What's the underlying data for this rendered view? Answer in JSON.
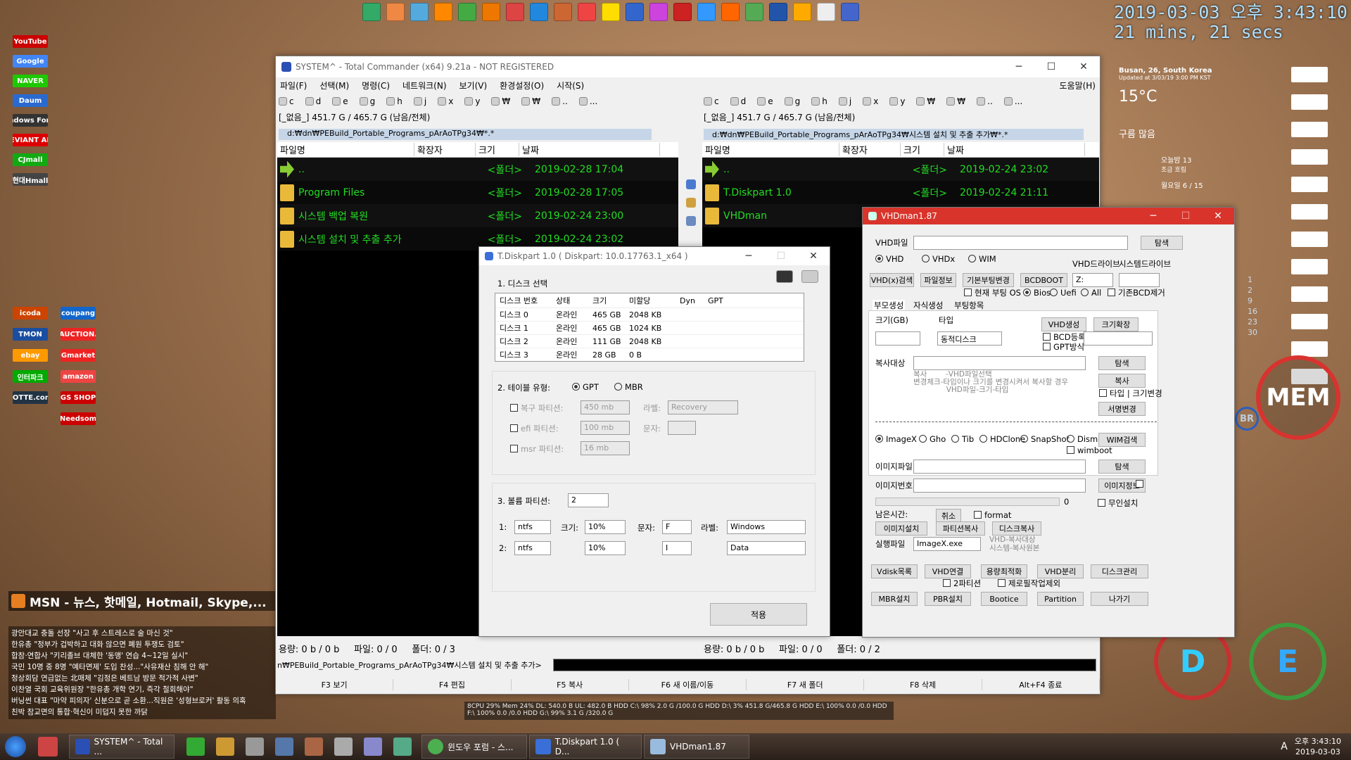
{
  "clock": {
    "date_time": "2019-03-03 오후 3:43:10",
    "uptime": "21 mins, 21 secs"
  },
  "weather": {
    "location": "Busan, 26, South Korea",
    "updated": "Updated at 3/03/19 3:00 PM KST",
    "temp": "15°C",
    "condition": "구름 많음",
    "today": "오늘밤 13",
    "today_note": "조금 흐림",
    "tomorrow": "월요일 6 / 15"
  },
  "calendar": [
    "1",
    "2",
    "9",
    "16",
    "23",
    "30"
  ],
  "left_sites": [
    "YouTube",
    "Google",
    "NAVER",
    "Daum",
    "Windows Forum",
    "DEVIANT ART",
    "CJmall",
    "현대Hmall",
    "coupang",
    "icoda",
    "AUCTION.",
    "TMON",
    "Gmarket",
    "ebay",
    "amazon",
    "인터파크",
    "GS SHOP",
    "LOTTE.com",
    "Needsom"
  ],
  "msn": {
    "title": "MSN - 뉴스, 핫메일, Hotmail, Skype,...",
    "headlines": [
      "광안대교 충돌 선장 \"사고 후 스트레스로 술 마신 것\"",
      "한유총 \"정부가 겁박하고 대화 않으면 폐원 투쟁도 검토\"",
      "합참·연합사 \"키리졸브 대체한 '동맹' 연습 4~12일 실시\"",
      "국민 10명 중 8명 \"예타면제' 도입 찬성...\"사유재산 침해 안 해\"",
      "정상회담 연급없는 北매체 \"김정은 베트남 방문 적가적 사변\"",
      "이찬열 국회 교육위원장 \"한유총 개학 연기, 즉각 철회해야\"",
      "버닝썬 대표 \"마약 피의자' 신분으로 곧 소환...직원은 '성형브로커' 활동 의혹",
      "친박 참교면의 통합·혁신이 미덥지 못한 까닭"
    ]
  },
  "tc": {
    "title": "SYSTEM^ - Total Commander (x64) 9.21a - NOT REGISTERED",
    "menu": [
      "파일(F)",
      "선택(M)",
      "명령(C)",
      "네트워크(N)",
      "보기(V)",
      "환경설정(O)",
      "시작(S)"
    ],
    "help": "도움말(H)",
    "drives": [
      "c",
      "d",
      "e",
      "g",
      "h",
      "j",
      "x",
      "y",
      "₩",
      "₩",
      "..",
      "..."
    ],
    "left": {
      "freeinfo": "[_없음_]  451.7 G / 465.7 G (남음/전체)",
      "path": "d:₩dn₩PEBuild_Portable_Programs_pArAoTPg34₩*.*",
      "cols": [
        "파일명",
        "확장자",
        "크기",
        "날짜"
      ],
      "rows": [
        {
          "name": "..",
          "size": "<폴더>",
          "date": "2019-02-28 17:04"
        },
        {
          "name": "Program Files",
          "size": "<폴더>",
          "date": "2019-02-28 17:05"
        },
        {
          "name": "시스템 백업 복원",
          "size": "<폴더>",
          "date": "2019-02-24 23:00"
        },
        {
          "name": "시스템 설치 및 추출 추가",
          "size": "<폴더>",
          "date": "2019-02-24 23:02"
        }
      ],
      "status": "용량: 0 b / 0 b     파일: 0 / 0     폴더: 0 / 3"
    },
    "right": {
      "freeinfo": "[_없음_]  451.7 G / 465.7 G (남음/전체)",
      "path": "d:₩dn₩PEBuild_Portable_Programs_pArAoTPg34₩시스템 설치 및 추출 추가₩*.*",
      "cols": [
        "파일명",
        "확장자",
        "크기",
        "날짜"
      ],
      "rows": [
        {
          "name": "..",
          "size": "<폴더>",
          "date": "2019-02-24 23:02"
        },
        {
          "name": "T.Diskpart 1.0",
          "size": "<폴더>",
          "date": "2019-02-24 21:11"
        },
        {
          "name": "VHDman",
          "size": "",
          "date": ""
        }
      ],
      "status": "용량: 0 b / 0 b     파일: 0 / 0     폴더: 0 / 2"
    },
    "cmdline": "n₩PEBuild_Portable_Programs_pArAoTPg34₩시스템 설치 및 추출 추가>",
    "fkeys": [
      "F3 보기",
      "F4 편집",
      "F5 복사",
      "F6 새 이름/이동",
      "F7 새 폴더",
      "F8 삭제",
      "Alt+F4 종료"
    ]
  },
  "td": {
    "title": "T.Diskpart 1.0 ( Diskpart: 10.0.17763.1_x64 )",
    "sec1": "1. 디스크 선택",
    "cols": [
      "디스크 번호",
      "상태",
      "크기",
      "미할당",
      "Dyn",
      "GPT"
    ],
    "disks": [
      [
        "디스크 0",
        "온라인",
        "465 GB",
        "2048 KB"
      ],
      [
        "디스크 1",
        "온라인",
        "465 GB",
        "1024 KB"
      ],
      [
        "디스크 2",
        "온라인",
        "111 GB",
        "2048 KB"
      ],
      [
        "디스크 3",
        "온라인",
        "28 GB",
        "0 B"
      ]
    ],
    "sec2": "2. 테이블 유형:",
    "gpt": "GPT",
    "mbr": "MBR",
    "recovery": "복구 파티션:",
    "recovery_size": "450 mb",
    "label_txt": "라벨:",
    "recovery_label": "Recovery",
    "efi": "efi 파티션:",
    "efi_size": "100 mb",
    "letter_txt": "문자:",
    "msr": "msr 파티션:",
    "msr_size": "16 mb",
    "sec3": "3. 볼륨 파티션:",
    "vol_count": "2",
    "vols": [
      {
        "n": "1:",
        "fs": "ntfs",
        "size": "10%",
        "letter": "F",
        "label": "Windows"
      },
      {
        "n": "2:",
        "fs": "ntfs",
        "size": "10%",
        "letter": "I",
        "label": "Data"
      }
    ],
    "size_txt": "크기:",
    "letter2": "문자:",
    "label2": "라벨:",
    "apply": "적용"
  },
  "vhd": {
    "title": "VHDman1.87",
    "vhdfile": "VHD파일",
    "browse": "탐색",
    "r_vhd": "VHD",
    "r_vhdx": "VHDx",
    "r_wim": "WIM",
    "vhd_drive": "VHD드라이브",
    "sys_drive": "시스템드라이브",
    "drive_val": "Z:",
    "btn_search": "VHD(x)검색",
    "btn_info": "파일정보",
    "btn_bootchg": "기본부팅변경",
    "btn_bcd": "BCDBOOT",
    "cur_boot": "현재 부팅 OS",
    "bios": "Bios",
    "uefi": "Uefi",
    "all": "All",
    "bcd_remove": "기존BCD제거",
    "tabs": [
      "부모생성",
      "자식생성",
      "부팅항목"
    ],
    "size_gb": "크기(GB)",
    "type": "타입",
    "type_val": "동적디스크",
    "create": "VHD생성",
    "expand": "크기확장",
    "bcd_reg": "BCD등록",
    "gpt_mode": "GPT방식",
    "copy_target": "복사대상",
    "copy_note": "복사        -VHD파일선택\n변경체크-타입이나 크기를 변경시켜서 복사할 경우\n              VHD파일-크기-타입",
    "copy": "복사",
    "type_size_chg": "타입 | 크기변경",
    "sign_chg": "서명변경",
    "tools": [
      "ImageX",
      "Gho",
      "Tib",
      "HDClone",
      "SnapShot",
      "Dism"
    ],
    "wim_search": "WIM검색",
    "wimboot": "wimboot",
    "img_file": "이미지파일",
    "img_no": "이미지번호",
    "img_info": "이미지정보",
    "progress": "0",
    "unattended": "무인설치",
    "remain": "남은시간:",
    "cancel": "취소",
    "format": "format",
    "img_install": "이미지설치",
    "part_copy": "파티션복사",
    "disk_copy": "디스크복사",
    "exec_file": "실행파일",
    "exec_val": "ImageX.exe",
    "exec_note": "VHD-복사대상\n시스템-복사원본",
    "b1": [
      "Vdisk목록",
      "VHD연결",
      "용량최적화",
      "VHD분리",
      "디스크관리"
    ],
    "two_part": "2파티션",
    "zero_remove": "제로필작업제외",
    "b2": [
      "MBR설치",
      "PBR설치",
      "Bootice",
      "Partition",
      "나가기"
    ]
  },
  "sysbar": {
    "text": "8CPU 29%  Mem 24%  DL: 540.0 B  UL: 482.0 B  HDD C:\\ 98% 2.0 G /100.0 G  HDD D:\\ 3% 451.8 G/465.8 G  HDD E:\\ 100% 0.0 /0.0  HDD F:\\ 100% 0.0 /0.0  HDD G:\\ 99% 3.1 G /320.0 G"
  },
  "taskbar": {
    "items": [
      "SYSTEM^ - Total ...",
      "윈도우 포럼 - 스...",
      "T.Diskpart 1.0 ( D...",
      "VHDman1.87"
    ],
    "time": "오후 3:43:10",
    "date": "2019-03-03",
    "ime": "A"
  },
  "rings": {
    "mem": "MEM",
    "d": "D",
    "e": "E",
    "br": "BR"
  }
}
